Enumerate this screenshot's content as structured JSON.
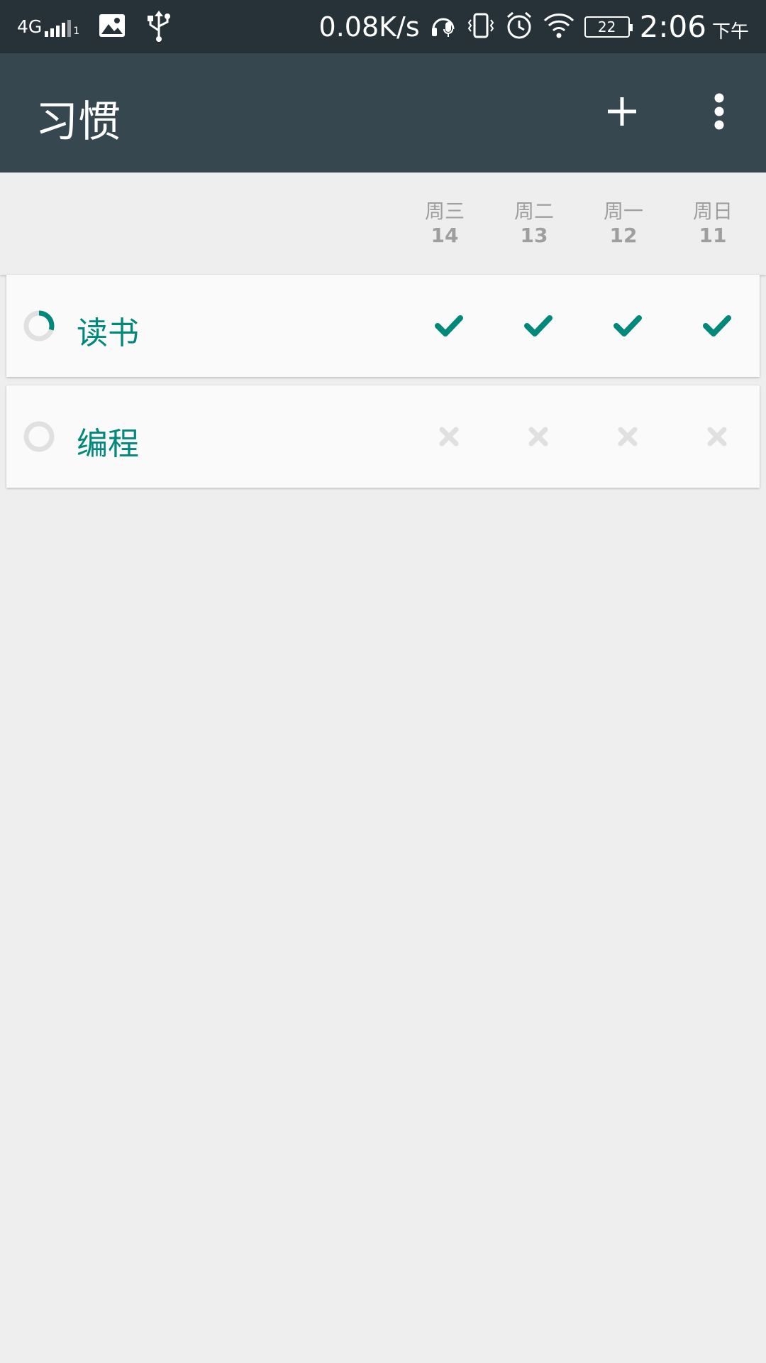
{
  "status_bar": {
    "network": "4G",
    "sim": "1",
    "speed": "0.08K/s",
    "battery": "22",
    "time": "2:06",
    "ampm": "下午",
    "icons": [
      "image-icon",
      "usb-icon",
      "headset-icon",
      "vibrate-icon",
      "alarm-icon",
      "wifi-icon"
    ]
  },
  "app_bar": {
    "title": "习惯",
    "add_icon": "add-icon",
    "more_icon": "more-vert-icon",
    "background": "#37474f"
  },
  "header": {
    "days": [
      {
        "name": "周三",
        "date": "14"
      },
      {
        "name": "周二",
        "date": "13"
      },
      {
        "name": "周一",
        "date": "12"
      },
      {
        "name": "周日",
        "date": "11"
      }
    ]
  },
  "habits": [
    {
      "name": "读书",
      "score": 0.3,
      "marks": [
        "check",
        "check",
        "check",
        "check"
      ]
    },
    {
      "name": "编程",
      "score": 0,
      "marks": [
        "cross",
        "cross",
        "cross",
        "cross"
      ]
    }
  ],
  "colors": {
    "accent": "#00897b",
    "inactive": "#e0e0e0",
    "header_text": "#9e9e9e",
    "status_bar": "#263238"
  }
}
